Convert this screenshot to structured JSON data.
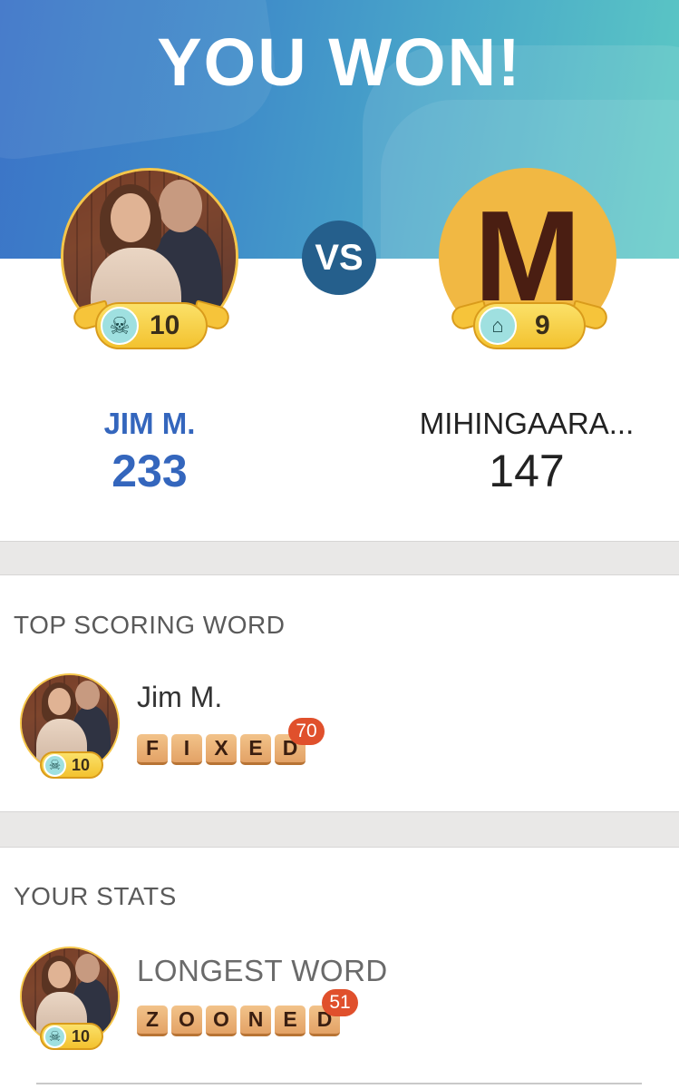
{
  "header": {
    "result_text": "YOU WON!",
    "gradient_colors": [
      "#3b73c7",
      "#5cc9c4"
    ]
  },
  "match": {
    "vs_label": "VS",
    "player1": {
      "name": "JIM M.",
      "score": "233",
      "level": "10",
      "badge_icon": "skull-crossbones-icon",
      "name_color": "#3466bd"
    },
    "player2": {
      "name": "MIHINGAARA...",
      "score": "147",
      "level": "9",
      "avatar_letter": "M",
      "badge_icon": "hat-icon",
      "avatar_color": "#f1b843"
    }
  },
  "top_scoring_word": {
    "section_title": "TOP SCORING WORD",
    "player_name": "Jim M.",
    "level": "10",
    "word_letters": [
      "F",
      "I",
      "X",
      "E",
      "D"
    ],
    "points": "70"
  },
  "your_stats": {
    "section_title": "YOUR STATS",
    "stat_label": "LONGEST WORD",
    "level": "10",
    "word_letters": [
      "Z",
      "O",
      "O",
      "N",
      "E",
      "D"
    ],
    "points": "51"
  }
}
